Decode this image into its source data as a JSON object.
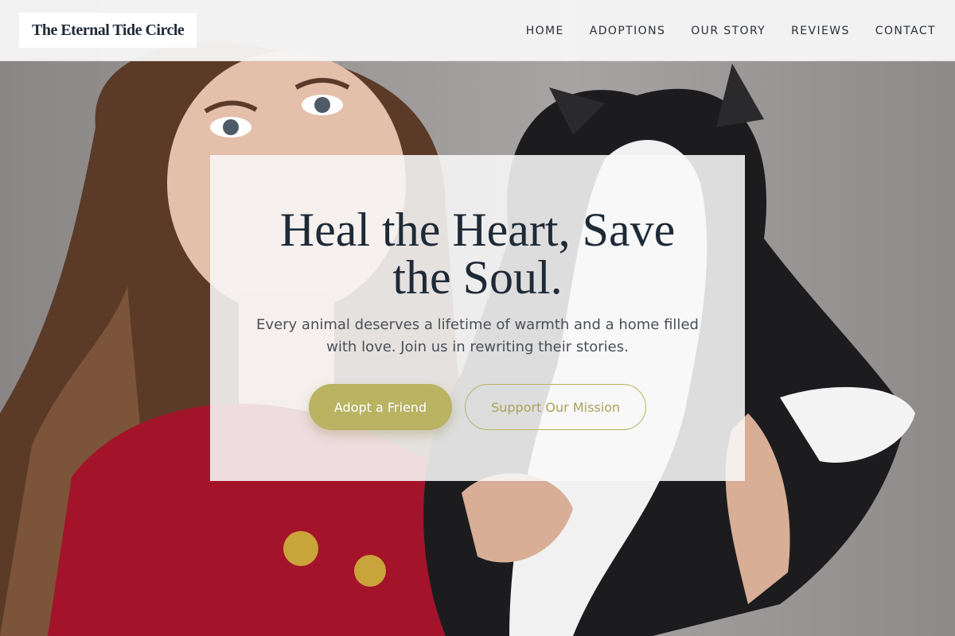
{
  "header": {
    "logo_text": "The Eternal Tide Circle",
    "nav": [
      {
        "label": "HOME"
      },
      {
        "label": "ADOPTIONS"
      },
      {
        "label": "OUR STORY"
      },
      {
        "label": "REVIEWS"
      },
      {
        "label": "CONTACT"
      }
    ]
  },
  "hero": {
    "title": "Heal the Heart, Save the Soul.",
    "subtitle": "Every animal deserves a lifetime of warmth and a home filled with love. Join us in rewriting their stories.",
    "primary_button": "Adopt a Friend",
    "secondary_button": "Support Our Mission",
    "image_subject": "woman in red sweater holding a black-and-white cat"
  },
  "colors": {
    "accent": "#b9b362",
    "text_dark": "#1f2a37",
    "sweater_red": "#a3142a"
  }
}
